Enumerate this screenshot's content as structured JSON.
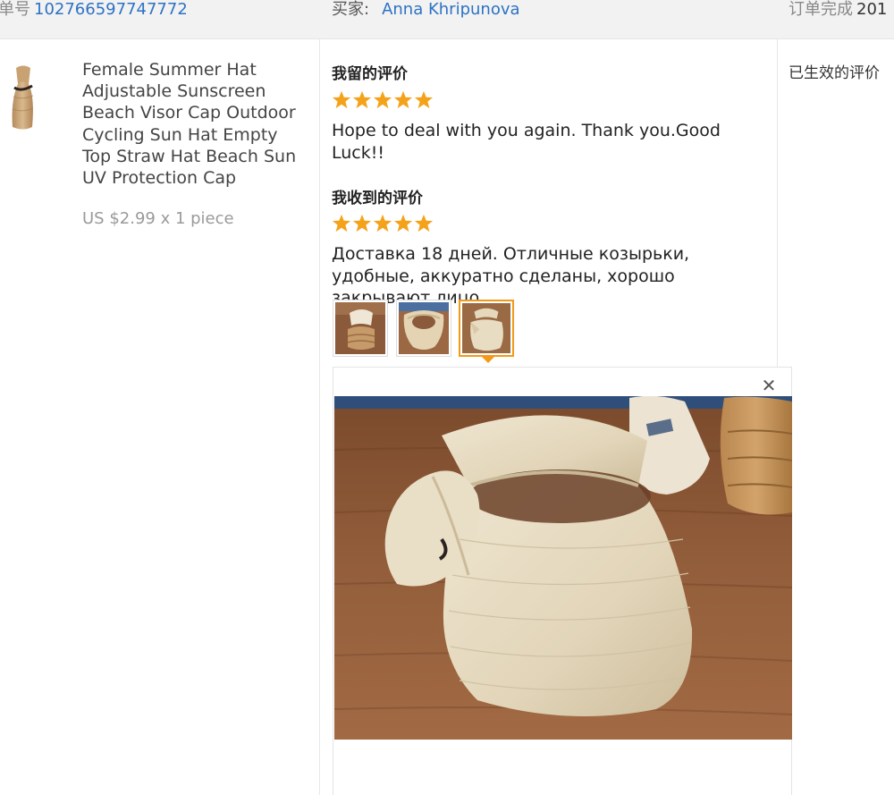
{
  "header": {
    "order_label": "单号",
    "order_number": "102766597747772",
    "buyer_label": "买家:",
    "buyer_name": "Anna Khripunova",
    "completed_label": "订单完成",
    "completed_year": "201"
  },
  "product": {
    "title": "Female Summer Hat Adjustable Sunscreen Beach Visor Cap Outdoor Cycling Sun Hat Empty Top Straw Hat Beach Sun UV Protection Cap",
    "price": "US $2.99 x 1 piece",
    "thumbnail_icon": "straw-visor-hat-icon"
  },
  "my_feedback": {
    "title": "我留的评价",
    "rating": 5,
    "text": "Hope to deal with you again. Thank you.Good Luck!!"
  },
  "received_feedback": {
    "title": "我收到的评价",
    "rating": 5,
    "text": "Доставка 18 дней. Отличные козырьки, удобные, аккуратно сделаны, хорошо закрывают лицо."
  },
  "photos": {
    "count": 3,
    "selected_index": 2,
    "close_icon": "close-icon",
    "close_glyph": "✕"
  },
  "status": {
    "text": "已生效的评价"
  },
  "colors": {
    "link_blue": "#2d72c4",
    "star_orange": "#f5a21b",
    "active_border": "#f29a1a",
    "header_bg": "#f2f2f2"
  }
}
